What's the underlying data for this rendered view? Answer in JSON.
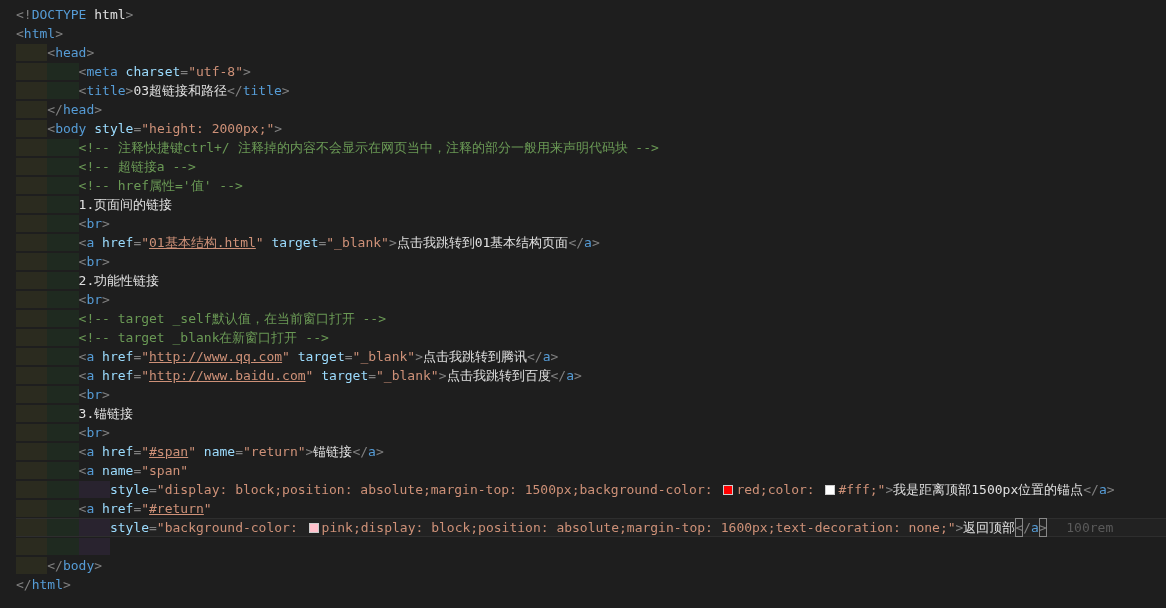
{
  "lines": [
    {
      "tokens": [
        {
          "kind": "punct",
          "text": "<!"
        },
        {
          "kind": "tag",
          "text": "DOCTYPE"
        },
        {
          "kind": "text",
          "text": " html"
        },
        {
          "kind": "punct",
          "text": ">"
        }
      ]
    },
    {
      "tokens": [
        {
          "kind": "punct",
          "text": "<"
        },
        {
          "kind": "tag",
          "text": "html"
        },
        {
          "kind": "punct",
          "text": ">"
        }
      ],
      "children": [
        {
          "tokens": [
            {
              "kind": "punct",
              "text": "<"
            },
            {
              "kind": "tag",
              "text": "head"
            },
            {
              "kind": "punct",
              "text": ">"
            }
          ],
          "children": [
            {
              "tokens": [
                {
                  "kind": "punct",
                  "text": "<"
                },
                {
                  "kind": "tag",
                  "text": "meta"
                },
                {
                  "kind": "attr",
                  "text": " charset"
                },
                {
                  "kind": "punct",
                  "text": "="
                },
                {
                  "kind": "str",
                  "text": "\"utf-8\""
                },
                {
                  "kind": "punct",
                  "text": ">"
                }
              ]
            },
            {
              "tokens": [
                {
                  "kind": "punct",
                  "text": "<"
                },
                {
                  "kind": "tag",
                  "text": "title"
                },
                {
                  "kind": "punct",
                  "text": ">"
                },
                {
                  "kind": "text",
                  "text": "03超链接和路径"
                },
                {
                  "kind": "punct",
                  "text": "</"
                },
                {
                  "kind": "tag",
                  "text": "title"
                },
                {
                  "kind": "punct",
                  "text": ">"
                }
              ]
            }
          ]
        },
        {
          "tokens": [
            {
              "kind": "punct",
              "text": "</"
            },
            {
              "kind": "tag",
              "text": "head"
            },
            {
              "kind": "punct",
              "text": ">"
            }
          ]
        },
        {
          "tokens": [
            {
              "kind": "punct",
              "text": "<"
            },
            {
              "kind": "tag",
              "text": "body"
            },
            {
              "kind": "attr",
              "text": " style"
            },
            {
              "kind": "punct",
              "text": "="
            },
            {
              "kind": "str",
              "text": "\"height: 2000px;\""
            },
            {
              "kind": "punct",
              "text": ">"
            }
          ],
          "children": [
            {
              "tokens": [
                {
                  "kind": "comment",
                  "text": "<!-- 注释快捷键ctrl+/ 注释掉的内容不会显示在网页当中，注释的部分一般用来声明代码块 -->"
                }
              ]
            },
            {
              "tokens": [
                {
                  "kind": "comment",
                  "text": "<!-- 超链接a -->"
                }
              ]
            },
            {
              "tokens": [
                {
                  "kind": "comment",
                  "text": "<!-- href属性='值' -->"
                }
              ]
            },
            {
              "tokens": [
                {
                  "kind": "text",
                  "text": "1.页面间的链接"
                }
              ]
            },
            {
              "tokens": [
                {
                  "kind": "punct",
                  "text": "<"
                },
                {
                  "kind": "tag",
                  "text": "br"
                },
                {
                  "kind": "punct",
                  "text": ">"
                }
              ]
            },
            {
              "tokens": [
                {
                  "kind": "punct",
                  "text": "<"
                },
                {
                  "kind": "tag",
                  "text": "a"
                },
                {
                  "kind": "attr",
                  "text": " href"
                },
                {
                  "kind": "punct",
                  "text": "="
                },
                {
                  "kind": "str",
                  "text": "\""
                },
                {
                  "kind": "link",
                  "text": "01基本结构.html"
                },
                {
                  "kind": "str",
                  "text": "\""
                },
                {
                  "kind": "attr",
                  "text": " target"
                },
                {
                  "kind": "punct",
                  "text": "="
                },
                {
                  "kind": "str",
                  "text": "\"_blank\""
                },
                {
                  "kind": "punct",
                  "text": ">"
                },
                {
                  "kind": "text",
                  "text": "点击我跳转到01基本结构页面"
                },
                {
                  "kind": "punct",
                  "text": "</"
                },
                {
                  "kind": "tag",
                  "text": "a"
                },
                {
                  "kind": "punct",
                  "text": ">"
                }
              ]
            },
            {
              "tokens": [
                {
                  "kind": "punct",
                  "text": "<"
                },
                {
                  "kind": "tag",
                  "text": "br"
                },
                {
                  "kind": "punct",
                  "text": ">"
                }
              ]
            },
            {
              "tokens": [
                {
                  "kind": "text",
                  "text": "2.功能性链接"
                }
              ]
            },
            {
              "tokens": [
                {
                  "kind": "punct",
                  "text": "<"
                },
                {
                  "kind": "tag",
                  "text": "br"
                },
                {
                  "kind": "punct",
                  "text": ">"
                }
              ]
            },
            {
              "tokens": [
                {
                  "kind": "comment",
                  "text": "<!-- target _self默认值，在当前窗口打开 -->"
                }
              ]
            },
            {
              "tokens": [
                {
                  "kind": "comment",
                  "text": "<!-- target _blank在新窗口打开 -->"
                }
              ]
            },
            {
              "tokens": [
                {
                  "kind": "punct",
                  "text": "<"
                },
                {
                  "kind": "tag",
                  "text": "a"
                },
                {
                  "kind": "attr",
                  "text": " href"
                },
                {
                  "kind": "punct",
                  "text": "="
                },
                {
                  "kind": "str",
                  "text": "\""
                },
                {
                  "kind": "link",
                  "text": "http://www.qq.com"
                },
                {
                  "kind": "str",
                  "text": "\""
                },
                {
                  "kind": "attr",
                  "text": " target"
                },
                {
                  "kind": "punct",
                  "text": "="
                },
                {
                  "kind": "str",
                  "text": "\"_blank\""
                },
                {
                  "kind": "punct",
                  "text": ">"
                },
                {
                  "kind": "text",
                  "text": "点击我跳转到腾讯"
                },
                {
                  "kind": "punct",
                  "text": "</"
                },
                {
                  "kind": "tag",
                  "text": "a"
                },
                {
                  "kind": "punct",
                  "text": ">"
                }
              ]
            },
            {
              "tokens": [
                {
                  "kind": "punct",
                  "text": "<"
                },
                {
                  "kind": "tag",
                  "text": "a"
                },
                {
                  "kind": "attr",
                  "text": " href"
                },
                {
                  "kind": "punct",
                  "text": "="
                },
                {
                  "kind": "str",
                  "text": "\""
                },
                {
                  "kind": "link",
                  "text": "http://www.baidu.com"
                },
                {
                  "kind": "str",
                  "text": "\""
                },
                {
                  "kind": "attr",
                  "text": " target"
                },
                {
                  "kind": "punct",
                  "text": "="
                },
                {
                  "kind": "str",
                  "text": "\"_blank\""
                },
                {
                  "kind": "punct",
                  "text": ">"
                },
                {
                  "kind": "text",
                  "text": "点击我跳转到百度"
                },
                {
                  "kind": "punct",
                  "text": "</"
                },
                {
                  "kind": "tag",
                  "text": "a"
                },
                {
                  "kind": "punct",
                  "text": ">"
                }
              ]
            },
            {
              "tokens": [
                {
                  "kind": "punct",
                  "text": "<"
                },
                {
                  "kind": "tag",
                  "text": "br"
                },
                {
                  "kind": "punct",
                  "text": ">"
                }
              ]
            },
            {
              "tokens": [
                {
                  "kind": "text",
                  "text": "3.锚链接"
                }
              ]
            },
            {
              "tokens": [
                {
                  "kind": "punct",
                  "text": "<"
                },
                {
                  "kind": "tag",
                  "text": "br"
                },
                {
                  "kind": "punct",
                  "text": ">"
                }
              ]
            },
            {
              "tokens": [
                {
                  "kind": "punct",
                  "text": "<"
                },
                {
                  "kind": "tag",
                  "text": "a"
                },
                {
                  "kind": "attr",
                  "text": " href"
                },
                {
                  "kind": "punct",
                  "text": "="
                },
                {
                  "kind": "str",
                  "text": "\""
                },
                {
                  "kind": "link",
                  "text": "#span"
                },
                {
                  "kind": "str",
                  "text": "\""
                },
                {
                  "kind": "attr",
                  "text": " name"
                },
                {
                  "kind": "punct",
                  "text": "="
                },
                {
                  "kind": "str",
                  "text": "\"return\""
                },
                {
                  "kind": "punct",
                  "text": ">"
                },
                {
                  "kind": "text",
                  "text": "锚链接"
                },
                {
                  "kind": "punct",
                  "text": "</"
                },
                {
                  "kind": "tag",
                  "text": "a"
                },
                {
                  "kind": "punct",
                  "text": ">"
                }
              ]
            },
            {
              "tokens": [
                {
                  "kind": "punct",
                  "text": "<"
                },
                {
                  "kind": "tag",
                  "text": "a"
                },
                {
                  "kind": "attr",
                  "text": " name"
                },
                {
                  "kind": "punct",
                  "text": "="
                },
                {
                  "kind": "str",
                  "text": "\"span\""
                }
              ],
              "children": [
                {
                  "tokens": [
                    {
                      "kind": "attr",
                      "text": "style"
                    },
                    {
                      "kind": "punct",
                      "text": "="
                    },
                    {
                      "kind": "str",
                      "text": "\"display: block;position: absolute;margin-top: 1500px;background-color: "
                    },
                    {
                      "kind": "swatch",
                      "color": "#ff0000"
                    },
                    {
                      "kind": "str",
                      "text": "red;color: "
                    },
                    {
                      "kind": "swatch",
                      "color": "#ffffff"
                    },
                    {
                      "kind": "str",
                      "text": "#fff;\""
                    },
                    {
                      "kind": "punct",
                      "text": ">"
                    },
                    {
                      "kind": "text",
                      "text": "我是距离顶部1500px位置的锚点"
                    },
                    {
                      "kind": "punct",
                      "text": "</"
                    },
                    {
                      "kind": "tag",
                      "text": "a"
                    },
                    {
                      "kind": "punct",
                      "text": ">"
                    }
                  ]
                }
              ]
            },
            {
              "tokens": [
                {
                  "kind": "punct",
                  "text": "<"
                },
                {
                  "kind": "tag",
                  "text": "a"
                },
                {
                  "kind": "attr",
                  "text": " href"
                },
                {
                  "kind": "punct",
                  "text": "="
                },
                {
                  "kind": "str",
                  "text": "\""
                },
                {
                  "kind": "link",
                  "text": "#return"
                },
                {
                  "kind": "str",
                  "text": "\""
                }
              ],
              "children": [
                {
                  "current": true,
                  "tokens": [
                    {
                      "kind": "attr",
                      "text": "style"
                    },
                    {
                      "kind": "punct",
                      "text": "="
                    },
                    {
                      "kind": "str",
                      "text": "\"background-color: "
                    },
                    {
                      "kind": "swatch",
                      "color": "#ffc0cb"
                    },
                    {
                      "kind": "str",
                      "text": "pink;display: block;position: absolute;margin-top: 1600px;text-decoration: none;\""
                    },
                    {
                      "kind": "punct",
                      "text": ">"
                    },
                    {
                      "kind": "text",
                      "text": "返回顶部"
                    },
                    {
                      "kind": "match",
                      "text": "<"
                    },
                    {
                      "kind": "punct",
                      "text": "/"
                    },
                    {
                      "kind": "tag",
                      "text": "a"
                    },
                    {
                      "kind": "match",
                      "text": ">"
                    },
                    {
                      "kind": "hint",
                      "text": "100rem"
                    }
                  ],
                  "blank_line_after": true
                }
              ]
            }
          ]
        },
        {
          "tokens": [
            {
              "kind": "punct",
              "text": "</"
            },
            {
              "kind": "tag",
              "text": "body"
            },
            {
              "kind": "punct",
              "text": ">"
            }
          ]
        }
      ]
    },
    {
      "tokens": [
        {
          "kind": "punct",
          "text": "</"
        },
        {
          "kind": "tag",
          "text": "html"
        },
        {
          "kind": "punct",
          "text": ">"
        }
      ]
    }
  ]
}
